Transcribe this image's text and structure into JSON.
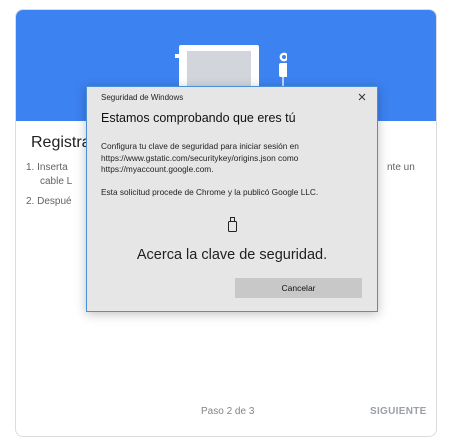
{
  "background_page": {
    "title": "Registra t",
    "steps": [
      "1. Inserta",
      "cable L",
      "2. Despué"
    ],
    "step_suffix": "nte un",
    "step_counter": "Paso 2 de 3",
    "next_label": "SIGUIENTE",
    "hero_color": "#3d82f1"
  },
  "dialog": {
    "window_title": "Seguridad de Windows",
    "heading": "Estamos comprobando que eres tú",
    "body": "Configura tu clave de seguridad para iniciar sesión en https://www.gstatic.com/securitykey/origins.json como https://myaccount.google.com.",
    "source": "Esta solicitud procede de Chrome y la publicó Google LLC.",
    "action_text": "Acerca la clave de seguridad.",
    "cancel_label": "Cancelar",
    "key_icon": "usb-key-icon",
    "close_icon": "close-icon",
    "border_color": "#4a90d9"
  }
}
